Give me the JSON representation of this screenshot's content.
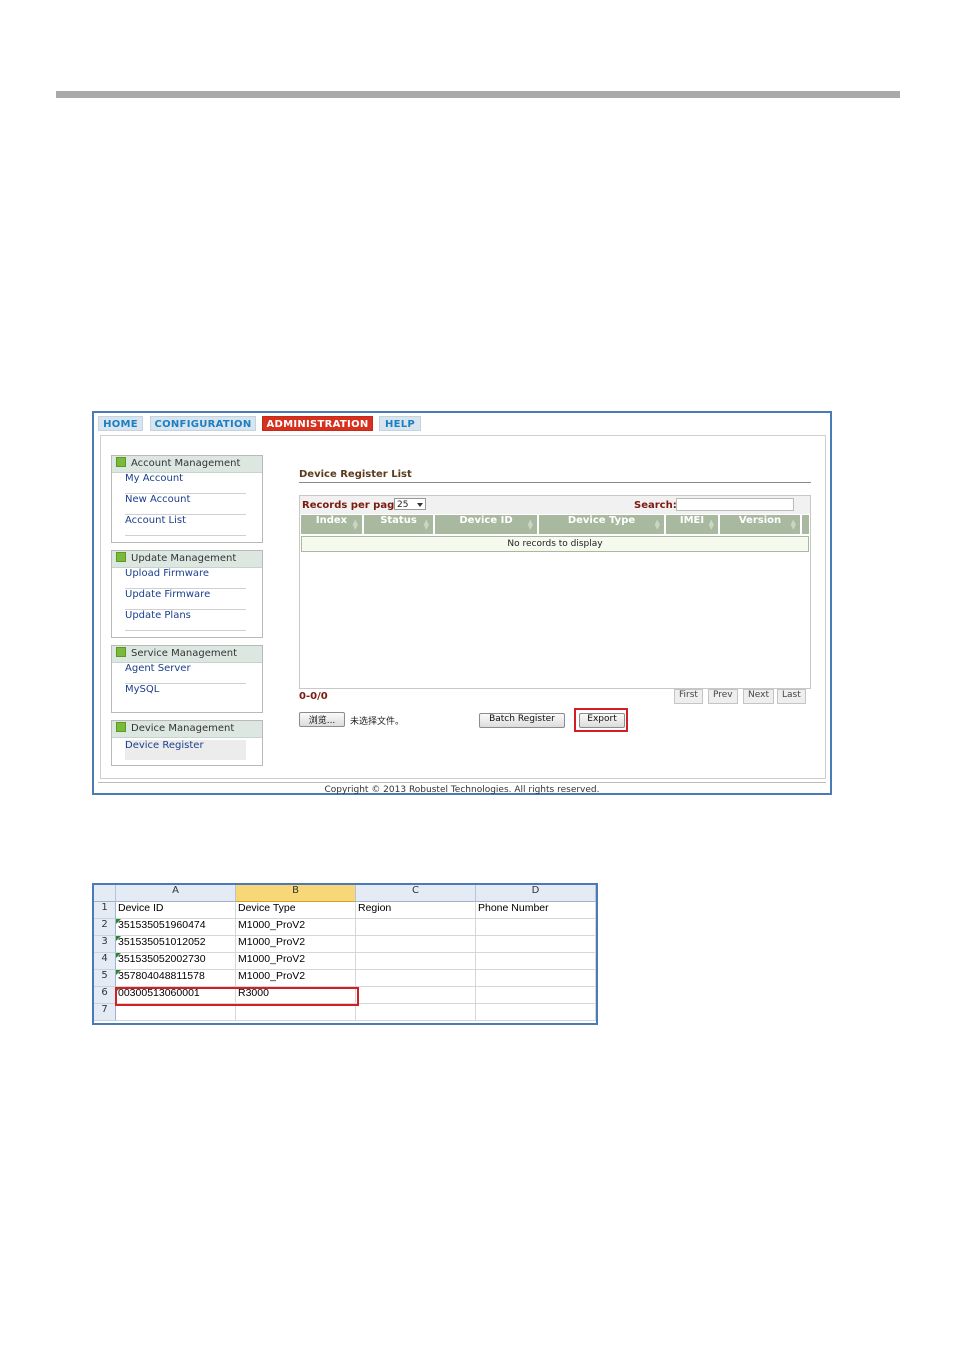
{
  "nav": {
    "tabs": [
      {
        "label": "HOME"
      },
      {
        "label": "CONFIGURATION"
      },
      {
        "label": "ADMINISTRATION"
      },
      {
        "label": "HELP"
      }
    ]
  },
  "sidebar": {
    "groups": [
      {
        "title": "Account Management",
        "items": [
          "My Account",
          "New Account",
          "Account List"
        ]
      },
      {
        "title": "Update Management",
        "items": [
          "Upload Firmware",
          "Update Firmware",
          "Update Plans"
        ]
      },
      {
        "title": "Service Management",
        "items": [
          "Agent Server",
          "MySQL"
        ]
      },
      {
        "title": "Device Management",
        "items": [
          "Device Register"
        ]
      }
    ]
  },
  "panel": {
    "title": "Device Register List",
    "records_label": "Records per page:",
    "records_value": "25",
    "search_label": "Search:",
    "columns": [
      "Index",
      "Status",
      "Device ID",
      "Device Type",
      "IMEI",
      "Version"
    ],
    "empty_message": "No records to display",
    "count": "0-0/0",
    "pager": {
      "first": "First",
      "prev": "Prev",
      "next": "Next",
      "last": "Last"
    },
    "browse_label": "浏览...",
    "no_file_label": "未选择文件。",
    "batch_label": "Batch Register",
    "export_label": "Export"
  },
  "footer": {
    "copyright": "Copyright © 2013 Robustel Technologies. All rights reserved."
  },
  "sheet": {
    "col_letters": [
      "A",
      "B",
      "C",
      "D"
    ],
    "row_numbers": [
      "1",
      "2",
      "3",
      "4",
      "5",
      "6",
      "7"
    ],
    "rows": [
      [
        "Device ID",
        "Device Type",
        "Region",
        "Phone Number"
      ],
      [
        "351535051960474",
        "M1000_ProV2",
        "",
        ""
      ],
      [
        "351535051012052",
        "M1000_ProV2",
        "",
        ""
      ],
      [
        "351535052002730",
        "M1000_ProV2",
        "",
        ""
      ],
      [
        "357804048811578",
        "M1000_ProV2",
        "",
        ""
      ],
      [
        "00300513060001",
        "R3000",
        "",
        ""
      ],
      [
        "",
        "",
        "",
        ""
      ]
    ]
  },
  "colors": {
    "accent_red": "#d7301f",
    "tab_blue": "#1c7fc1",
    "highlight_border": "#d21f26",
    "header_green": "#a8b9a0"
  }
}
